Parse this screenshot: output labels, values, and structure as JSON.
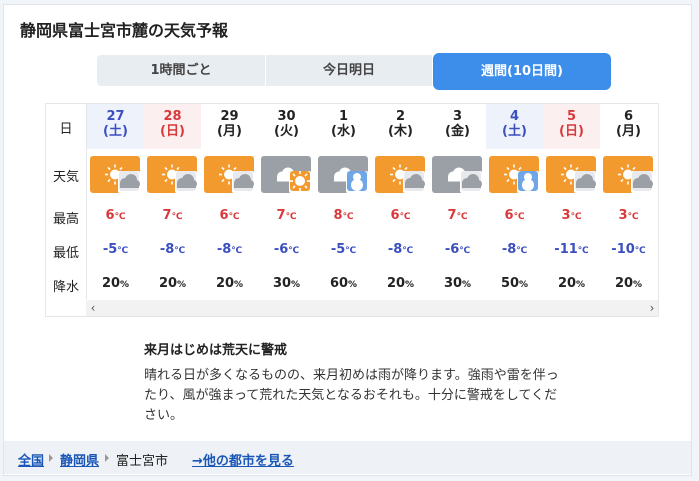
{
  "title": "静岡県富士宮市麓の天気予報",
  "tabs": [
    {
      "label": "1時間ごと"
    },
    {
      "label": "今日明日"
    },
    {
      "label": "週間(10日間)"
    }
  ],
  "row_labels": {
    "date": "日",
    "weather": "天気",
    "high": "最高",
    "low": "最低",
    "precip": "降水"
  },
  "days": [
    {
      "date": "27",
      "weekday": "(土)",
      "type": "sat",
      "icon": "sunny-then-cloudy-icon",
      "high": "6",
      "low": "-5",
      "pop": "20"
    },
    {
      "date": "28",
      "weekday": "(日)",
      "type": "sun",
      "icon": "sunny-then-cloudy-icon",
      "high": "7",
      "low": "-8",
      "pop": "20"
    },
    {
      "date": "29",
      "weekday": "(月)",
      "type": "wkd",
      "icon": "sunny-then-cloudy-icon",
      "high": "6",
      "low": "-8",
      "pop": "20"
    },
    {
      "date": "30",
      "weekday": "(火)",
      "type": "wkd",
      "icon": "cloudy-then-sunny-icon",
      "high": "7",
      "low": "-6",
      "pop": "30"
    },
    {
      "date": "1",
      "weekday": "(水)",
      "type": "wkd",
      "icon": "cloudy-then-snow-icon",
      "high": "8",
      "low": "-5",
      "pop": "60"
    },
    {
      "date": "2",
      "weekday": "(木)",
      "type": "wkd",
      "icon": "sunny-then-cloudy-icon",
      "high": "6",
      "low": "-8",
      "pop": "20"
    },
    {
      "date": "3",
      "weekday": "(金)",
      "type": "wkd",
      "icon": "cloudy-then-cloudy-icon",
      "high": "7",
      "low": "-6",
      "pop": "30"
    },
    {
      "date": "4",
      "weekday": "(土)",
      "type": "sat",
      "icon": "sunny-then-snow-icon",
      "high": "6",
      "low": "-8",
      "pop": "50"
    },
    {
      "date": "5",
      "weekday": "(日)",
      "type": "sun",
      "icon": "sunny-then-cloudy-icon",
      "high": "3",
      "low": "-11",
      "pop": "20"
    },
    {
      "date": "6",
      "weekday": "(月)",
      "type": "wkd",
      "icon": "sunny-then-cloudy-icon",
      "high": "3",
      "low": "-10",
      "pop": "20"
    }
  ],
  "units": {
    "temp": "℃",
    "pop": "%"
  },
  "comment": {
    "title": "来月はじめは荒天に警戒",
    "body": "晴れる日が多くなるものの、来月初めは雨が降ります。強雨や雷を伴ったり、風が強まって荒れた天気となるおそれも。十分に警戒をしてください。"
  },
  "breadcrumb": {
    "items": [
      "全国",
      "静岡県",
      "富士宮市"
    ],
    "other_link": "→他の都市を見る"
  },
  "colors": {
    "accent": "#3d8eea",
    "sun_bg": "#f29a2e",
    "cloud_bg": "#9aa0a6",
    "snow_bg": "#6fa6e6",
    "saturday": "#3b4fbf",
    "sunday": "#d9393b"
  }
}
